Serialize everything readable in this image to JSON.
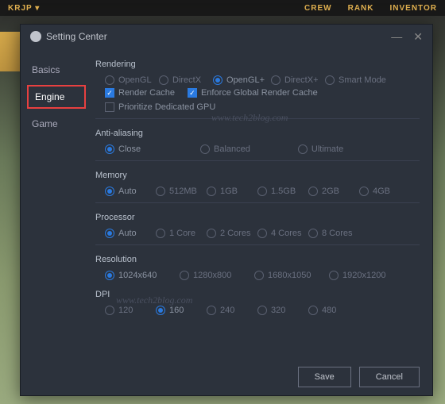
{
  "topbar": {
    "left": "KRJP ▾",
    "crew": "CREW",
    "rank": "RANK",
    "inventory": "INVENTOR"
  },
  "window": {
    "title": "Setting Center"
  },
  "sidebar": {
    "basics": "Basics",
    "engine": "Engine",
    "game": "Game"
  },
  "sections": {
    "rendering": {
      "label": "Rendering",
      "opengl": "OpenGL",
      "directx": "DirectX",
      "openglp": "OpenGL+",
      "directxp": "DirectX+",
      "smart": "Smart Mode",
      "render_cache": "Render Cache",
      "enforce_cache": "Enforce Global Render Cache",
      "prioritize_gpu": "Prioritize Dedicated GPU"
    },
    "antialiasing": {
      "label": "Anti-aliasing",
      "close": "Close",
      "balanced": "Balanced",
      "ultimate": "Ultimate"
    },
    "memory": {
      "label": "Memory",
      "auto": "Auto",
      "m512": "512MB",
      "m1": "1GB",
      "m15": "1.5GB",
      "m2": "2GB",
      "m4": "4GB"
    },
    "processor": {
      "label": "Processor",
      "auto": "Auto",
      "c1": "1 Core",
      "c2": "2 Cores",
      "c4": "4 Cores",
      "c8": "8 Cores"
    },
    "resolution": {
      "label": "Resolution",
      "r1": "1024x640",
      "r2": "1280x800",
      "r3": "1680x1050",
      "r4": "1920x1200"
    },
    "dpi": {
      "label": "DPI",
      "d120": "120",
      "d160": "160",
      "d240": "240",
      "d320": "320",
      "d480": "480"
    }
  },
  "buttons": {
    "save": "Save",
    "cancel": "Cancel"
  },
  "watermark": "www.tech2blog.com"
}
